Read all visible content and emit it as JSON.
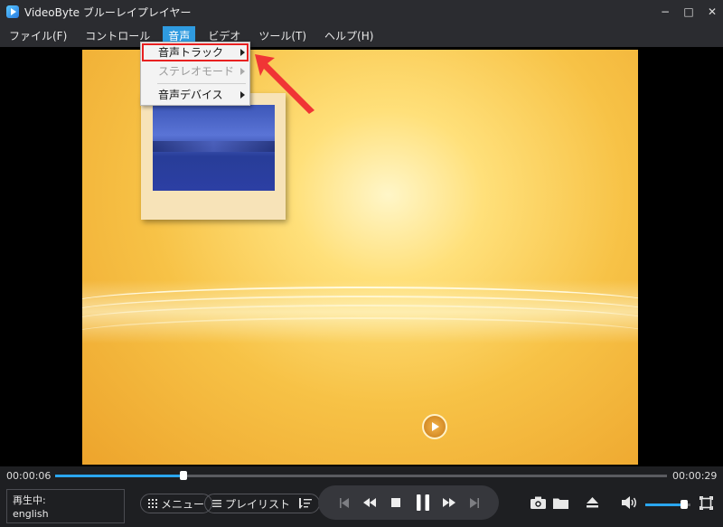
{
  "window": {
    "title": "VideoByte ブルーレイプレイヤー",
    "controls": {
      "minimize": "−",
      "maximize": "□",
      "close": "✕"
    }
  },
  "menubar": {
    "items": [
      {
        "label": "ファイル(F)"
      },
      {
        "label": "コントロール"
      },
      {
        "label": "音声"
      },
      {
        "label": "ビデオ"
      },
      {
        "label": "ツール(T)"
      },
      {
        "label": "ヘルプ(H)"
      }
    ],
    "active_index": 2
  },
  "audio_menu": {
    "items": [
      {
        "label": "音声トラック",
        "has_submenu": true,
        "enabled": true,
        "highlighted": true
      },
      {
        "label": "ステレオモード",
        "has_submenu": true,
        "enabled": false
      },
      {
        "label": "音声デバイス",
        "has_submenu": true,
        "enabled": true
      }
    ]
  },
  "playback": {
    "elapsed": "00:00:06",
    "duration": "00:00:29",
    "progress_fraction": 0.21,
    "volume_fraction": 0.85
  },
  "status": {
    "label": "再生中:",
    "track": "english"
  },
  "buttons": {
    "menu_label": "メニュー",
    "playlist_label": "プレイリスト"
  },
  "icons": {
    "menu": "grid-icon",
    "playlist": "list-icon",
    "sort": "sort-icon",
    "prev": "skip-previous-icon",
    "rewind": "rewind-icon",
    "stop": "stop-icon",
    "pause": "pause-icon",
    "forward": "fast-forward-icon",
    "next": "skip-next-icon",
    "snapshot": "camera-icon",
    "open": "folder-icon",
    "eject": "eject-icon",
    "volume": "speaker-icon",
    "fullscreen": "fullscreen-icon"
  },
  "colors": {
    "accent": "#2aa6ef",
    "highlight_border": "#e82020",
    "menu_active": "#2f9be0"
  }
}
